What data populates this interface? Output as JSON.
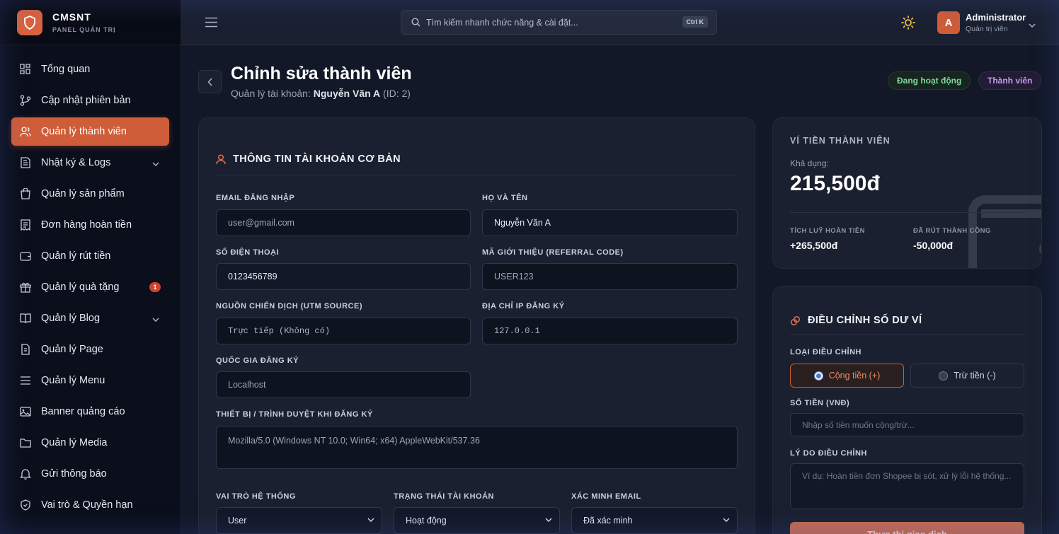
{
  "brand": {
    "name": "CMSNT",
    "sub": "PANEL QUẢN TRỊ"
  },
  "sidebar": {
    "items": [
      {
        "label": "Tổng quan",
        "icon": "dashboard-icon"
      },
      {
        "label": "Cập nhật phiên bản",
        "icon": "git-branch-icon"
      },
      {
        "label": "Quản lý thành viên",
        "icon": "users-icon",
        "active": true
      },
      {
        "label": "Nhật ký & Logs",
        "icon": "logs-icon",
        "expandable": true
      },
      {
        "label": "Quản lý sản phẩm",
        "icon": "shopping-bag-icon"
      },
      {
        "label": "Đơn hàng hoàn tiền",
        "icon": "receipt-icon"
      },
      {
        "label": "Quản lý rút tiền",
        "icon": "wallet-icon"
      },
      {
        "label": "Quản lý quà tặng",
        "icon": "gift-icon",
        "badge": "1"
      },
      {
        "label": "Quản lý Blog",
        "icon": "book-icon",
        "expandable": true
      },
      {
        "label": "Quản lý Page",
        "icon": "file-icon"
      },
      {
        "label": "Quản lý Menu",
        "icon": "menu-icon"
      },
      {
        "label": "Banner quảng cáo",
        "icon": "image-icon"
      },
      {
        "label": "Quản lý Media",
        "icon": "folder-icon"
      },
      {
        "label": "Gửi thông báo",
        "icon": "bell-icon"
      },
      {
        "label": "Vai trò & Quyền hạn",
        "icon": "shield-icon"
      }
    ]
  },
  "topbar": {
    "search_placeholder": "Tìm kiếm nhanh chức năng & cài đặt...",
    "shortcut": "Ctrl K",
    "user_name": "Administrator",
    "user_role": "Quản trị viên",
    "avatar_letter": "A"
  },
  "page": {
    "title": "Chỉnh sửa thành viên",
    "sub_prefix": "Quản lý tài khoản:",
    "sub_name": "Nguyễn Văn A",
    "sub_id": "(ID: 2)",
    "status_badge": "Đang hoạt động",
    "role_badge": "Thành viên"
  },
  "basic": {
    "title": "THÔNG TIN TÀI KHOẢN CƠ BẢN",
    "email_label": "EMAIL ĐĂNG NHẬP",
    "email_value": "user@gmail.com",
    "name_label": "HỌ VÀ TÊN",
    "name_value": "Nguyễn Văn A",
    "phone_label": "SỐ ĐIỆN THOẠI",
    "phone_value": "0123456789",
    "ref_label": "MÃ GIỚI THIỆU (REFERRAL CODE)",
    "ref_value": "USER123",
    "utm_label": "NGUỒN CHIẾN DỊCH (UTM SOURCE)",
    "utm_value": "Trực tiếp (Không có)",
    "ip_label": "ĐỊA CHỈ IP ĐĂNG KÝ",
    "ip_value": "127.0.0.1",
    "country_label": "QUỐC GIA ĐĂNG KÝ",
    "country_value": "Localhost",
    "device_label": "THIẾT BỊ / TRÌNH DUYỆT KHI ĐĂNG KÝ",
    "device_value": "Mozilla/5.0 (Windows NT 10.0; Win64; x64) AppleWebKit/537.36",
    "role_label": "VAI TRÒ HỆ THỐNG",
    "role_value": "User",
    "status_label": "TRẠNG THÁI TÀI KHOẢN",
    "status_value": "Hoạt động",
    "verify_label": "XÁC MINH EMAIL",
    "verify_value": "Đã xác minh"
  },
  "wallet": {
    "title": "VÍ TIỀN THÀNH VIÊN",
    "available_label": "Khả dụng:",
    "balance": "215,500đ",
    "cashback_label": "TÍCH LUỸ HOÀN TIỀN",
    "cashback_value": "+265,500đ",
    "withdrawn_label": "ĐÃ RÚT THÀNH CÔNG",
    "withdrawn_value": "-50,000đ"
  },
  "adjust": {
    "title": "ĐIỀU CHỈNH SỐ DƯ VÍ",
    "type_label": "LOẠI ĐIỀU CHỈNH",
    "add_label": "Cộng tiền (+)",
    "sub_label": "Trừ tiền (-)",
    "amount_label": "SỐ TIỀN (VNĐ)",
    "amount_placeholder": "Nhập số tiền muốn cộng/trừ...",
    "reason_label": "LÝ DO ĐIỀU CHỈNH",
    "reason_placeholder": "Ví dụ: Hoàn tiền đơn Shopee bị sót, xử lý lỗi hệ thống...",
    "submit_label": "Thực thi giao dịch"
  },
  "colors": {
    "accent": "#cf5d3a",
    "active_green": "#7fd69b",
    "role_purple": "#c29cf2"
  }
}
